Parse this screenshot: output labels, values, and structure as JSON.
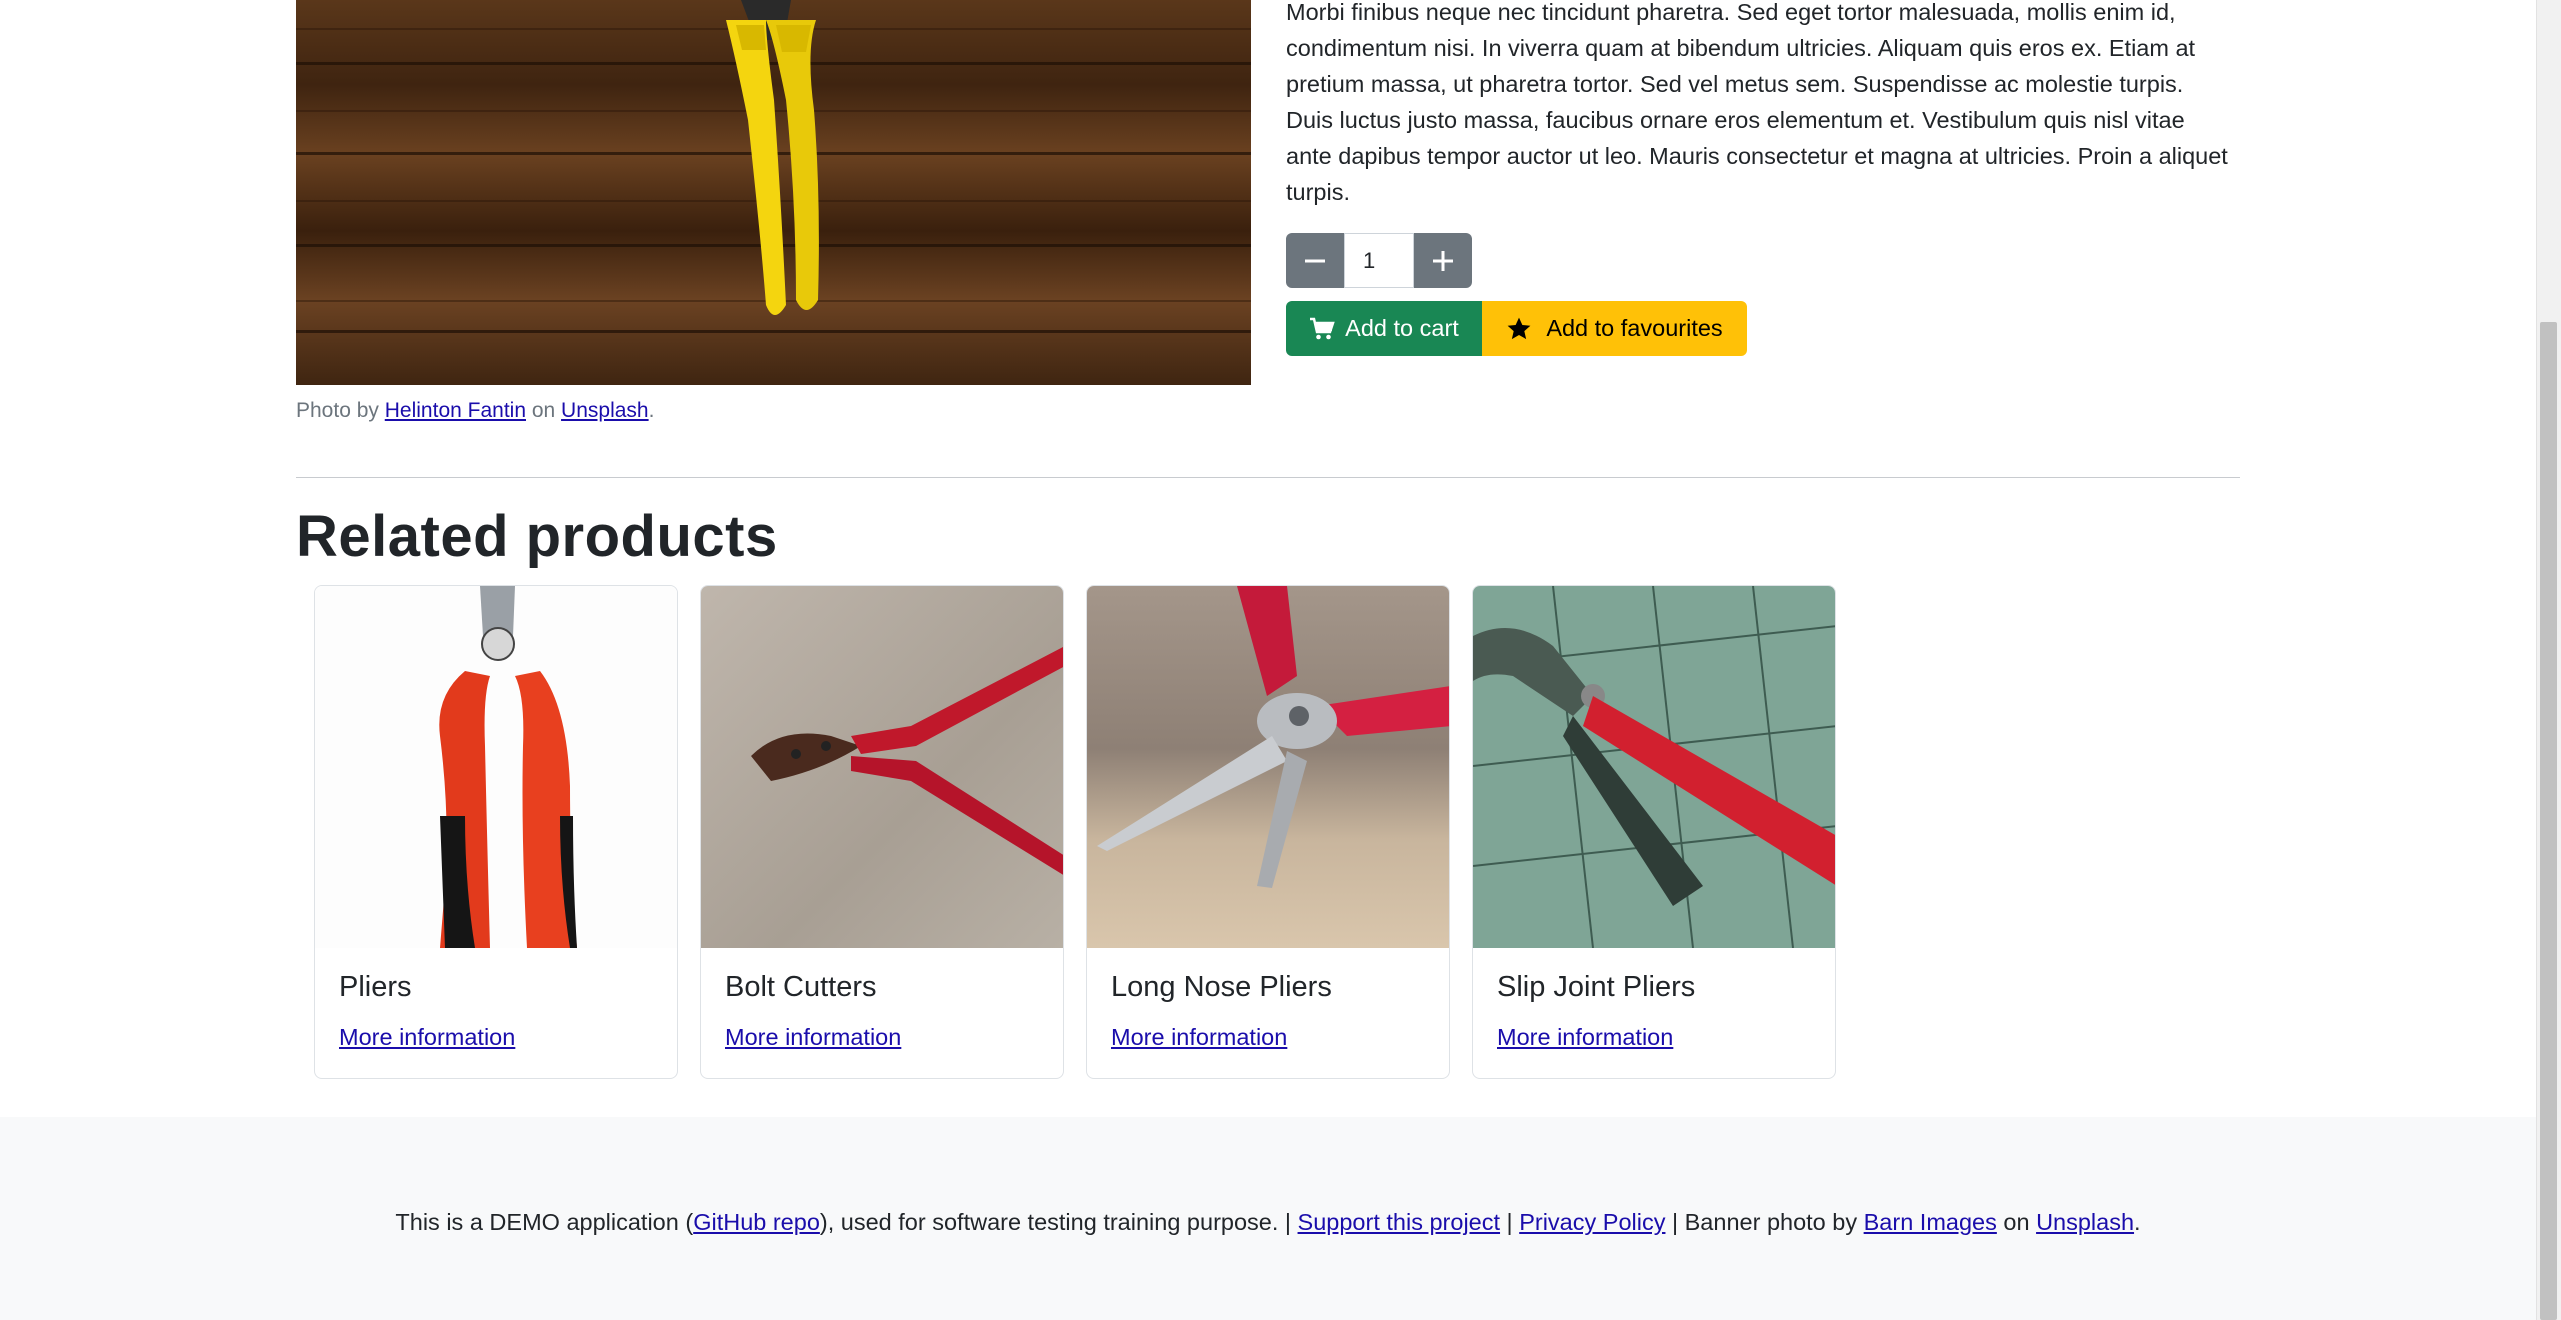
{
  "product": {
    "description": "Morbi finibus neque nec tincidunt pharetra. Sed eget tortor malesuada, mollis enim id, condimentum nisi. In viverra quam at bibendum ultricies. Aliquam quis eros ex. Etiam at pretium massa, ut pharetra tortor. Sed vel metus sem. Suspendisse ac molestie turpis. Duis luctus justo massa, faucibus ornare eros elementum et. Vestibulum quis nisl vitae ante dapibus tempor auctor ut leo. Mauris consectetur et magna at ultricies. Proin a aliquet turpis.",
    "quantity": "1",
    "add_to_cart": "Add to cart",
    "add_to_favourites": "Add to favourites",
    "photo_credit": {
      "prefix": "Photo by",
      "author": "Helinton Fantin",
      "on": "on",
      "source": "Unsplash",
      "suffix": "."
    }
  },
  "related": {
    "title": "Related products",
    "items": [
      {
        "name": "Pliers",
        "link": "More information"
      },
      {
        "name": "Bolt Cutters",
        "link": "More information"
      },
      {
        "name": "Long Nose Pliers",
        "link": "More information"
      },
      {
        "name": "Slip Joint Pliers",
        "link": "More information"
      }
    ]
  },
  "footer": {
    "t1": "This is a DEMO application (",
    "github": "GitHub repo",
    "t2": "), used for software testing training purpose. | ",
    "support": "Support this project",
    "t3": " | ",
    "privacy": "Privacy Policy",
    "t4": " | Banner photo by ",
    "barn": "Barn Images",
    "t5": " on ",
    "unsplash": "Unsplash",
    "t6": "."
  },
  "colors": {
    "success": "#198754",
    "warning": "#ffc107",
    "secondary": "#6c757d",
    "link": "#1a0dab"
  },
  "icons": [
    "minus-icon",
    "plus-icon",
    "cart-icon",
    "star-icon"
  ]
}
